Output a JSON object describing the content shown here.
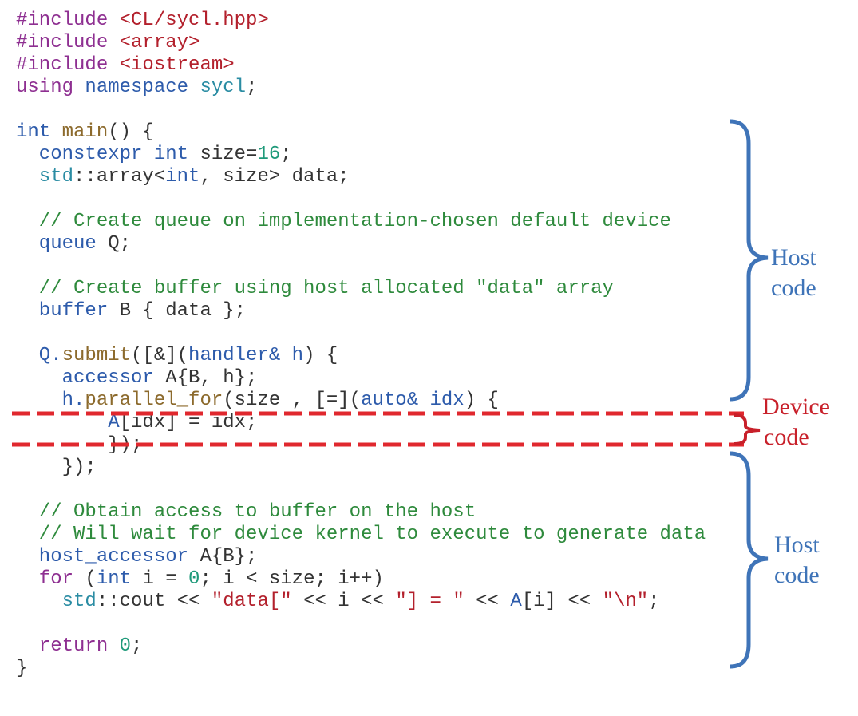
{
  "colors": {
    "pre": "#8e2f91",
    "str": "#b3202c",
    "kw": "#2d5bab",
    "ns": "#2a8ca3",
    "fn": "#8c6a2c",
    "cm": "#2e8a3c",
    "num": "#1f9a7a",
    "tx": "#333333",
    "host": "#3f74b8",
    "device": "#c8202a",
    "dash": "#e0282e"
  },
  "code_lines": [
    [
      [
        "#include ",
        "pre"
      ],
      [
        "<CL/sycl.hpp>",
        "str"
      ]
    ],
    [
      [
        "#include ",
        "pre"
      ],
      [
        "<array>",
        "str"
      ]
    ],
    [
      [
        "#include ",
        "pre"
      ],
      [
        "<iostream>",
        "str"
      ]
    ],
    [
      [
        "using ",
        "pre"
      ],
      [
        "namespace ",
        "kw"
      ],
      [
        "sycl",
        "ns"
      ],
      [
        ";",
        "tx"
      ]
    ],
    [],
    [
      [
        "int ",
        "kw"
      ],
      [
        "main",
        "fn"
      ],
      [
        "() {",
        "tx"
      ]
    ],
    [
      [
        "  constexpr int ",
        "kw"
      ],
      [
        "size=",
        "tx"
      ],
      [
        "16",
        "num"
      ],
      [
        ";",
        "tx"
      ]
    ],
    [
      [
        "  std",
        "ns"
      ],
      [
        "::array<",
        "tx"
      ],
      [
        "int",
        "kw"
      ],
      [
        ", size> data;",
        "tx"
      ]
    ],
    [],
    [
      [
        "  // Create queue on implementation-chosen default device",
        "cm"
      ]
    ],
    [
      [
        "  queue ",
        "kw"
      ],
      [
        "Q;",
        "tx"
      ]
    ],
    [],
    [
      [
        "  // Create buffer using host allocated \"data\" array",
        "cm"
      ]
    ],
    [
      [
        "  buffer ",
        "kw"
      ],
      [
        "B { data };",
        "tx"
      ]
    ],
    [],
    [
      [
        "  Q.",
        "kw"
      ],
      [
        "submit",
        "fn"
      ],
      [
        "([&](",
        "tx"
      ],
      [
        "handler& h",
        "kw"
      ],
      [
        ") {",
        "tx"
      ]
    ],
    [
      [
        "    accessor ",
        "kw"
      ],
      [
        "A{B, h};",
        "tx"
      ]
    ],
    [
      [
        "    h.",
        "kw"
      ],
      [
        "parallel_for",
        "fn"
      ],
      [
        "(size , [=](",
        "tx"
      ],
      [
        "auto& ",
        "kw"
      ],
      [
        "idx",
        "kw"
      ],
      [
        ") {",
        "tx"
      ]
    ],
    [
      [
        "        A",
        "kw"
      ],
      [
        "[idx] = idx;",
        "tx"
      ]
    ],
    [
      [
        "        });",
        "tx"
      ]
    ],
    [
      [
        "    });",
        "tx"
      ]
    ],
    [],
    [
      [
        "  // Obtain access to buffer on the host",
        "cm"
      ]
    ],
    [
      [
        "  // Will wait for device kernel to execute to generate data",
        "cm"
      ]
    ],
    [
      [
        "  host_accessor ",
        "kw"
      ],
      [
        "A{B};",
        "tx"
      ]
    ],
    [
      [
        "  for ",
        "pre"
      ],
      [
        "(",
        "tx"
      ],
      [
        "int ",
        "kw"
      ],
      [
        "i = ",
        "tx"
      ],
      [
        "0",
        "num"
      ],
      [
        "; i < size; i++)",
        "tx"
      ]
    ],
    [
      [
        "    std",
        "ns"
      ],
      [
        "::cout << ",
        "tx"
      ],
      [
        "\"data[\"",
        "str"
      ],
      [
        " << i << ",
        "tx"
      ],
      [
        "\"] = \"",
        "str"
      ],
      [
        " << ",
        "tx"
      ],
      [
        "A",
        "kw"
      ],
      [
        "[i] << ",
        "tx"
      ],
      [
        "\"\\n\"",
        "str"
      ],
      [
        ";",
        "tx"
      ]
    ],
    [],
    [
      [
        "  return ",
        "pre"
      ],
      [
        "0",
        "num"
      ],
      [
        ";",
        "tx"
      ]
    ],
    [
      [
        "}",
        "tx"
      ]
    ]
  ],
  "labels": {
    "host_top": [
      "Host",
      "code"
    ],
    "device": [
      "Device",
      "code"
    ],
    "host_bottom": [
      "Host",
      "code"
    ]
  }
}
